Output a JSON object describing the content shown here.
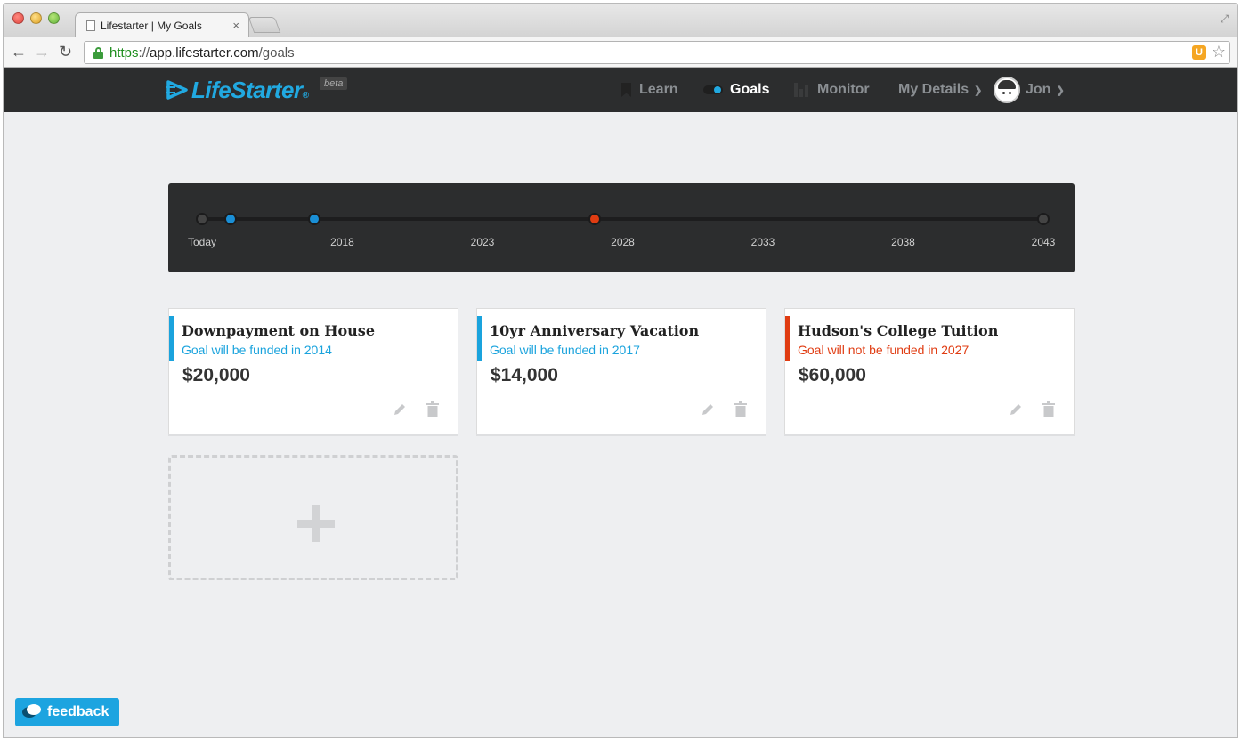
{
  "browser": {
    "tab_title": "Lifestarter | My Goals",
    "tab_close": "×",
    "url_scheme": "https",
    "url_sep": "://",
    "url_host": "app.lifestarter.com",
    "url_path": "/goals"
  },
  "header": {
    "logo_text": "LifeStarter",
    "logo_mark": "®",
    "beta": "beta",
    "nav": {
      "learn": "Learn",
      "goals": "Goals",
      "monitor": "Monitor",
      "details": "My Details",
      "user": "Jon"
    },
    "accent": "#21a9e1"
  },
  "timeline": {
    "labels": [
      "Today",
      "2018",
      "2023",
      "2028",
      "2033",
      "2038",
      "2043"
    ],
    "markers": [
      {
        "year": 2013,
        "status": "now",
        "color": "#444444"
      },
      {
        "year": 2014,
        "status": "funded",
        "color": "#1a8fd6"
      },
      {
        "year": 2017,
        "status": "funded",
        "color": "#1a8fd6"
      },
      {
        "year": 2027,
        "status": "not-funded",
        "color": "#e03c12"
      },
      {
        "year": 2043,
        "status": "end",
        "color": "#444444"
      }
    ]
  },
  "goals": [
    {
      "title": "Downpayment on House",
      "status": "Goal will be funded in 2014",
      "amount": "$20,000",
      "color": "#1aa3dd"
    },
    {
      "title": "10yr Anniversary Vacation",
      "status": "Goal will be funded in 2017",
      "amount": "$14,000",
      "color": "#1aa3dd"
    },
    {
      "title": "Hudson's College Tuition",
      "status": "Goal will not be funded in 2027",
      "amount": "$60,000",
      "color": "#e03c12"
    }
  ],
  "feedback_label": "feedback"
}
